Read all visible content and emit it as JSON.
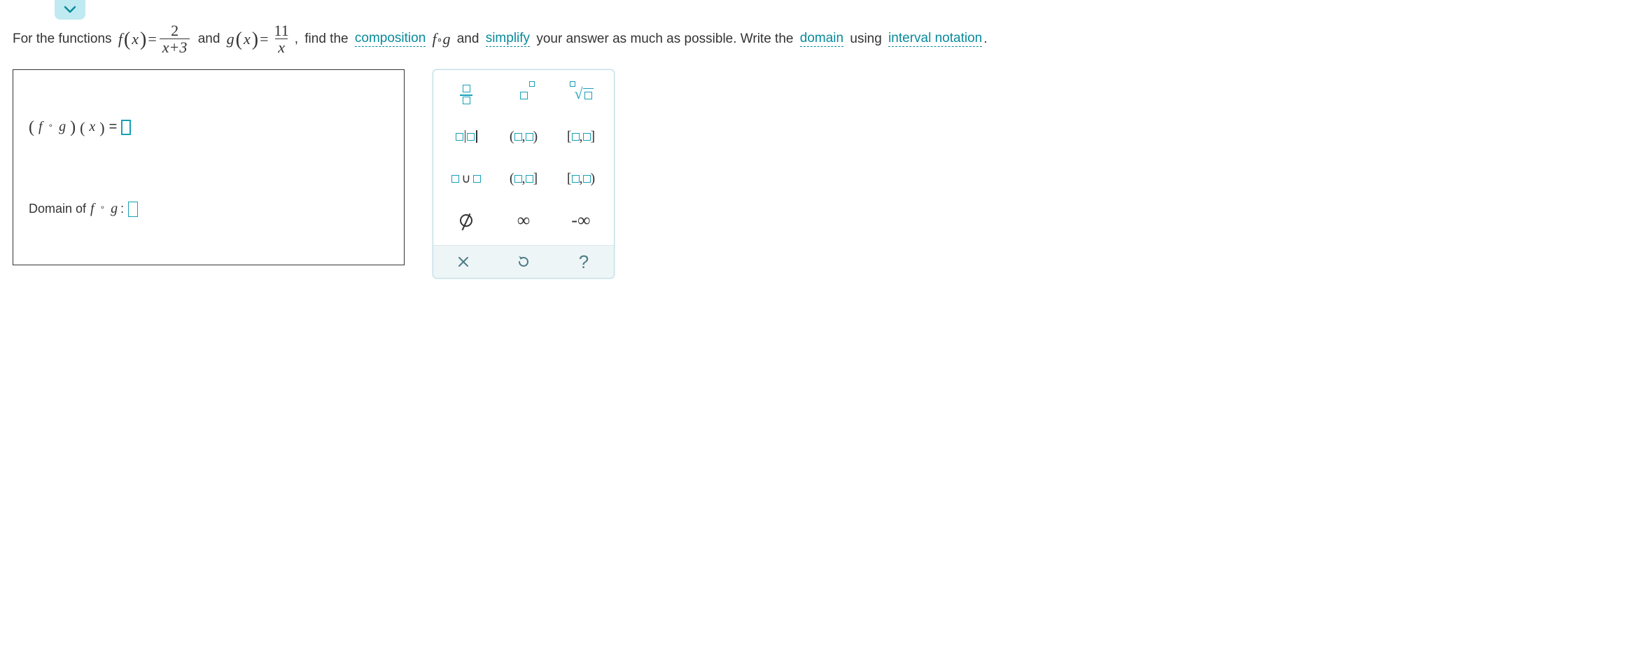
{
  "problem": {
    "lead": "For the functions",
    "f_label": "f",
    "var": "x",
    "eq": "=",
    "f_frac_num": "2",
    "f_frac_den": "x+3",
    "mid": "and",
    "g_label": "g",
    "g_frac_num": "11",
    "g_frac_den": "x",
    "comma": ",",
    "find": "find the",
    "composition_link": "composition",
    "fog_inline": "f ∘ g",
    "and2": "and",
    "simplify_link": "simplify",
    "tail1": "your answer as much as possible. Write the",
    "domain_link": "domain",
    "tail2": "using",
    "interval_link": "interval notation",
    "period": "."
  },
  "answer": {
    "fog_lhs_open": "(",
    "fog_f": "f",
    "fog_dot": "∘",
    "fog_g": "g",
    "fog_lhs_close": ")",
    "fog_x_open": "(",
    "fog_x": "x",
    "fog_x_close": ")",
    "fog_eq": "=",
    "domain_label_pre": "Domain of",
    "domain_f": "f",
    "domain_dot": "∘",
    "domain_g": "g",
    "domain_colon": ":"
  },
  "palette": {
    "frac_title": "fraction",
    "exp_title": "exponent",
    "sqrt_title": "nth-root",
    "abs_title": "absolute-value",
    "open_int": "(□,□)",
    "closed_int": "[□,□]",
    "union_title": "union",
    "half_open1": "(□,□]",
    "half_open2": "[□,□)",
    "empty_set": "∅",
    "infinity": "∞",
    "neg_infinity": "-∞",
    "clear": "×",
    "reset": "↺",
    "help": "?"
  }
}
